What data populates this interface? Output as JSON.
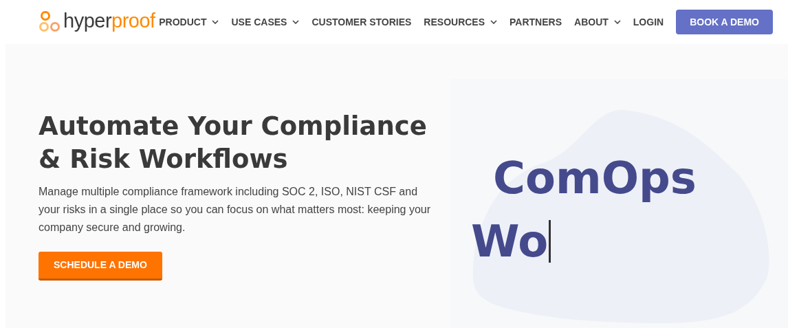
{
  "logo": {
    "dark_part": "hyper",
    "accent_part": "proof"
  },
  "nav": [
    {
      "label": "PRODUCT",
      "has_menu": true
    },
    {
      "label": "USE CASES",
      "has_menu": true
    },
    {
      "label": "CUSTOMER STORIES",
      "has_menu": false
    },
    {
      "label": "RESOURCES",
      "has_menu": true
    },
    {
      "label": "PARTNERS",
      "has_menu": false
    },
    {
      "label": "ABOUT",
      "has_menu": true
    },
    {
      "label": "LOGIN",
      "has_menu": false
    }
  ],
  "cta": "BOOK A DEMO",
  "hero": {
    "heading": "Automate Your Compliance & Risk Workflows",
    "text": "Manage multiple compliance framework including SOC 2, ISO, NIST CSF and your risks in a single place so you can focus on what matters most: keeping your company secure and growing.",
    "button": "SCHEDULE A DEMO"
  },
  "typing": {
    "lines": [
      "ComOps",
      "Wo"
    ],
    "cursor": true
  }
}
